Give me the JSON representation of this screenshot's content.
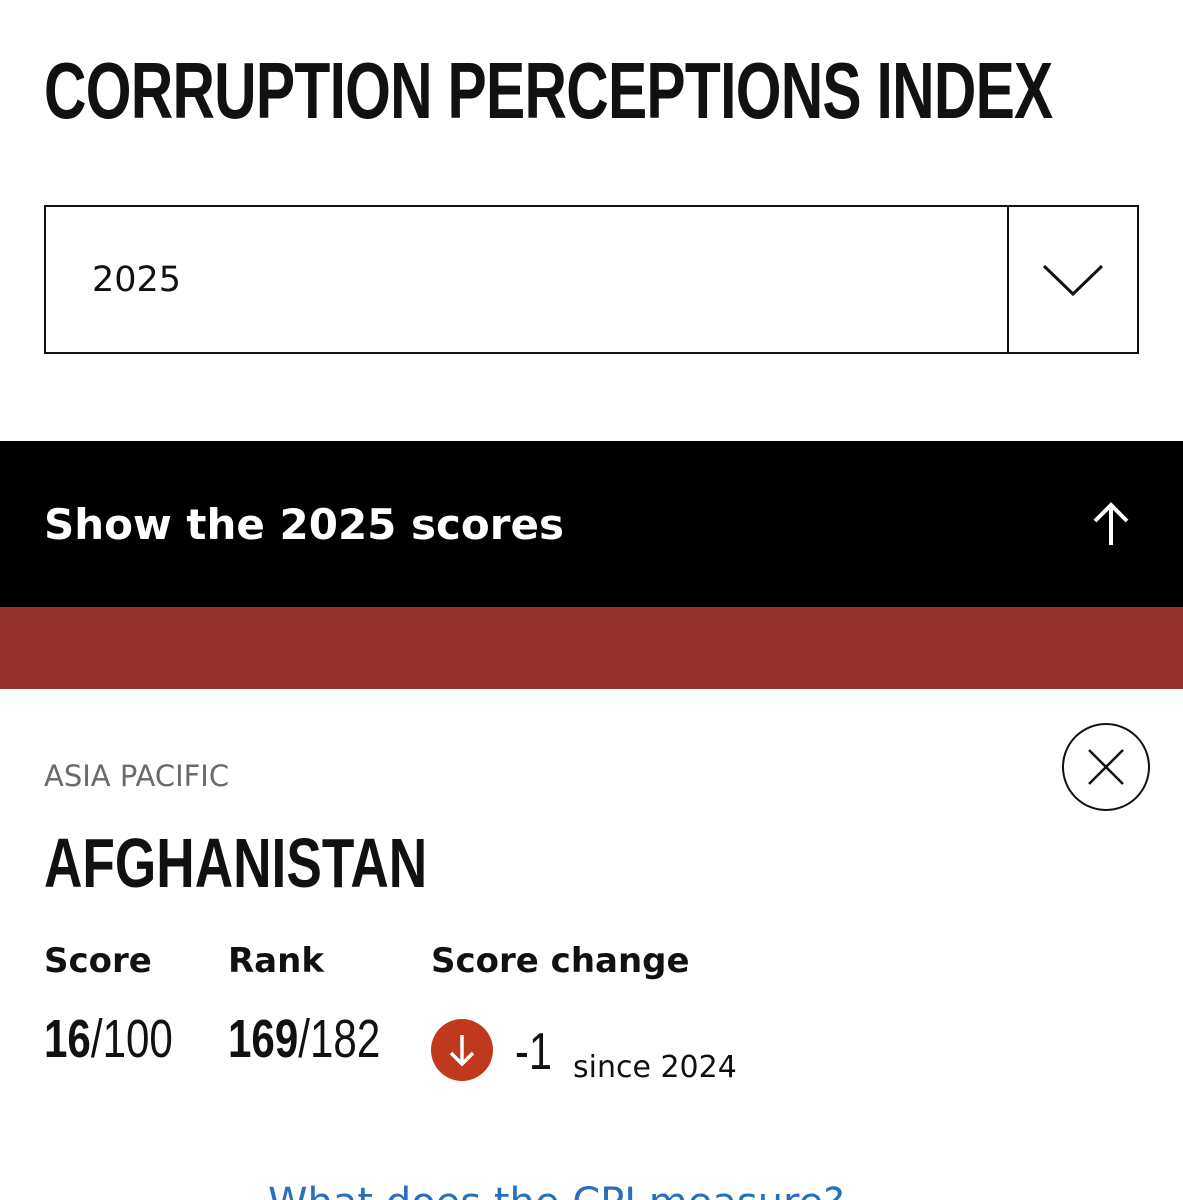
{
  "header": {
    "title": "CORRUPTION PERCEPTIONS INDEX"
  },
  "year_select": {
    "value": "2025",
    "toggle_icon": "chevron-down-icon"
  },
  "scores_bar": {
    "label": "Show the 2025 scores",
    "icon": "arrow-up-icon"
  },
  "map_strip": {
    "color": "#93332c"
  },
  "country_card": {
    "region": "ASIA PACIFIC",
    "name": "AFGHANISTAN",
    "close_icon": "close-icon",
    "score": {
      "label": "Score",
      "value": "16",
      "max": "/100"
    },
    "rank": {
      "label": "Rank",
      "value": "169",
      "total": "/182"
    },
    "score_change": {
      "label": "Score change",
      "value": "-1",
      "since": "since 2024",
      "direction": "down",
      "icon": "arrow-down-icon",
      "color": "#c0391f"
    }
  },
  "footer_link": {
    "text": "What does the CPI measure?"
  }
}
